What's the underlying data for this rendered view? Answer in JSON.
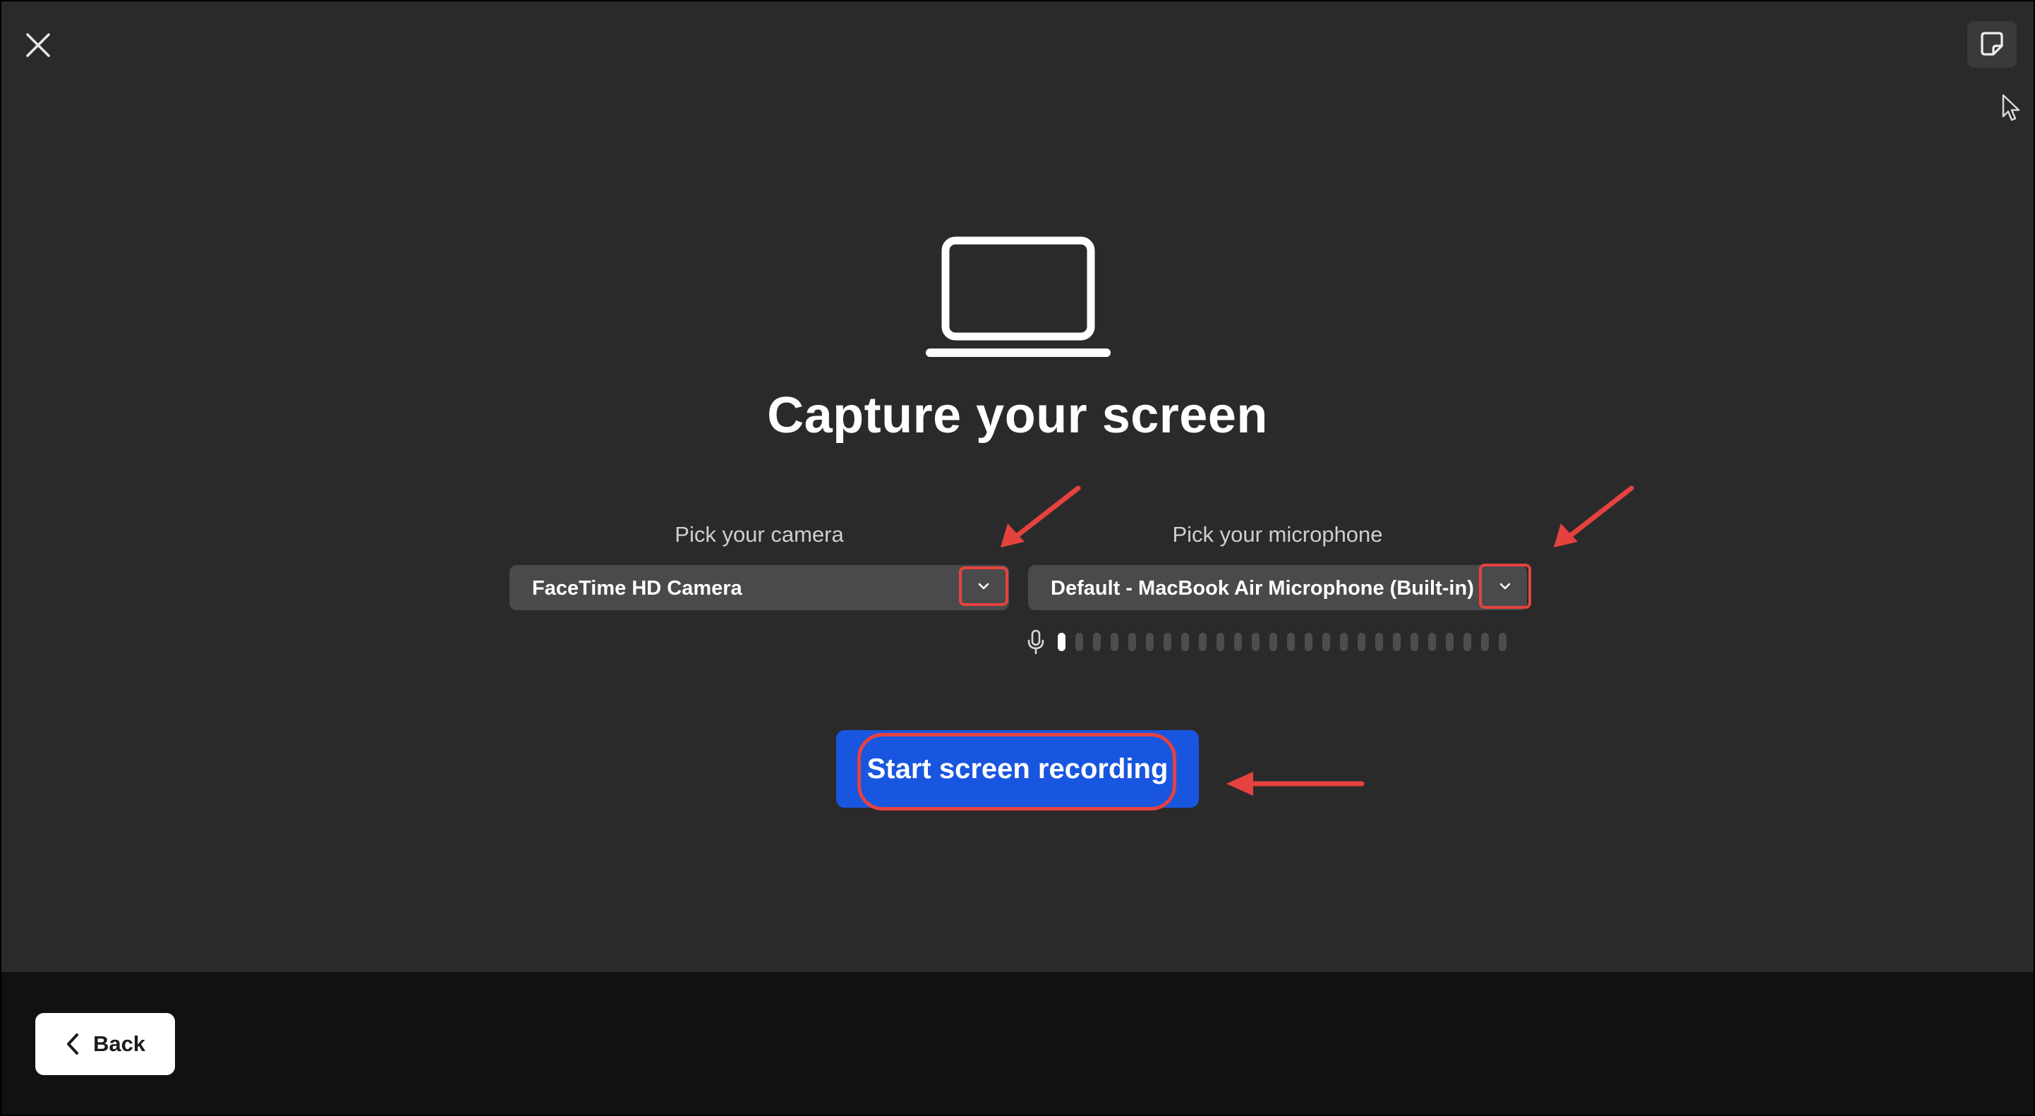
{
  "header": {
    "close_icon": "close-icon",
    "notes_icon": "sticky-note-icon"
  },
  "main": {
    "illustration_icon": "laptop-icon",
    "title": "Capture your screen",
    "camera": {
      "label": "Pick your camera",
      "selected": "FaceTime HD Camera",
      "dropdown_icon": "chevron-down-icon"
    },
    "microphone": {
      "label": "Pick your microphone",
      "selected": "Default - MacBook Air Microphone (Built-in)",
      "dropdown_icon": "chevron-down-icon",
      "level_icon": "microphone-icon",
      "level_total_bars": 26,
      "level_active_bars": 1
    },
    "start_button": "Start screen recording"
  },
  "footer": {
    "back_label": "Back",
    "back_icon": "chevron-left-icon"
  },
  "annotations": {
    "color": "#e5423f",
    "arrow_icon": "red-arrow-icon",
    "highlight_color": "#e5423f"
  },
  "colors": {
    "background": "#2a2a2b",
    "footer_background": "#111113",
    "primary_button": "#1956e0",
    "select_background": "#4a4a4c"
  }
}
